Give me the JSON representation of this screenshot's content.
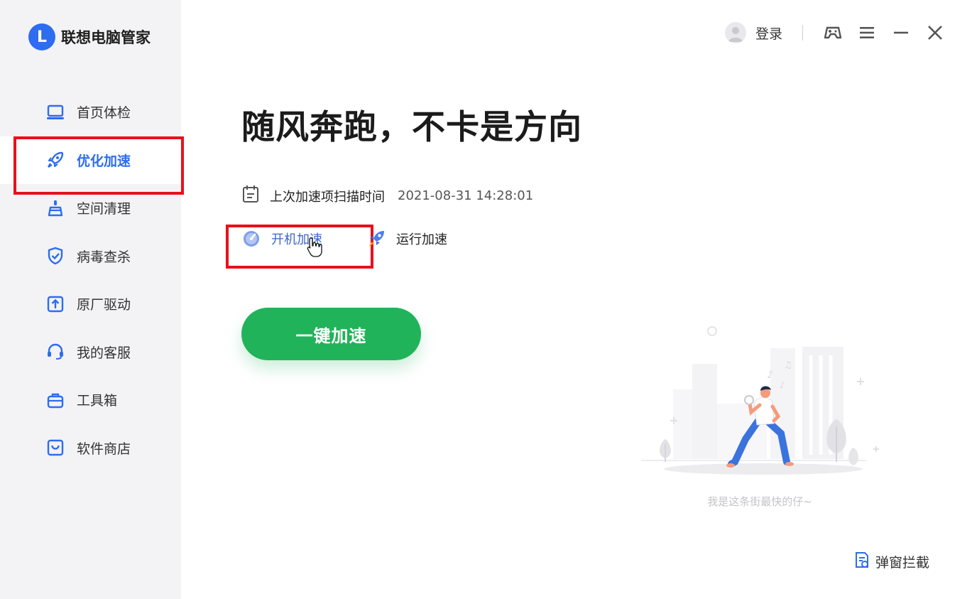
{
  "app": {
    "logo_letter": "L",
    "title": "联想电脑管家"
  },
  "sidebar": {
    "items": [
      {
        "label": "首页体检",
        "icon": "laptop-icon"
      },
      {
        "label": "优化加速",
        "icon": "rocket-icon",
        "active": true
      },
      {
        "label": "空间清理",
        "icon": "broom-icon"
      },
      {
        "label": "病毒查杀",
        "icon": "shield-icon"
      },
      {
        "label": "原厂驱动",
        "icon": "upload-box-icon"
      },
      {
        "label": "我的客服",
        "icon": "headset-icon"
      },
      {
        "label": "工具箱",
        "icon": "toolbox-icon"
      },
      {
        "label": "软件商店",
        "icon": "store-bag-icon"
      }
    ]
  },
  "topbar": {
    "login_label": "登录"
  },
  "main": {
    "headline": "随风奔跑，不卡是方向",
    "scan_label": "上次加速项扫描时间",
    "scan_time": "2021-08-31 14:28:01",
    "tabs": [
      {
        "label": "开机加速",
        "icon": "gauge-icon"
      },
      {
        "label": "运行加速",
        "icon": "rocket-icon"
      }
    ],
    "speed_button": "一键加速",
    "illustration_caption": "我是这条街最快的仔~",
    "popup_block_label": "弹窗拦截"
  },
  "colors": {
    "accent": "#2e6cf0",
    "button_green": "#21b35a",
    "highlight_red": "#e8101a"
  }
}
